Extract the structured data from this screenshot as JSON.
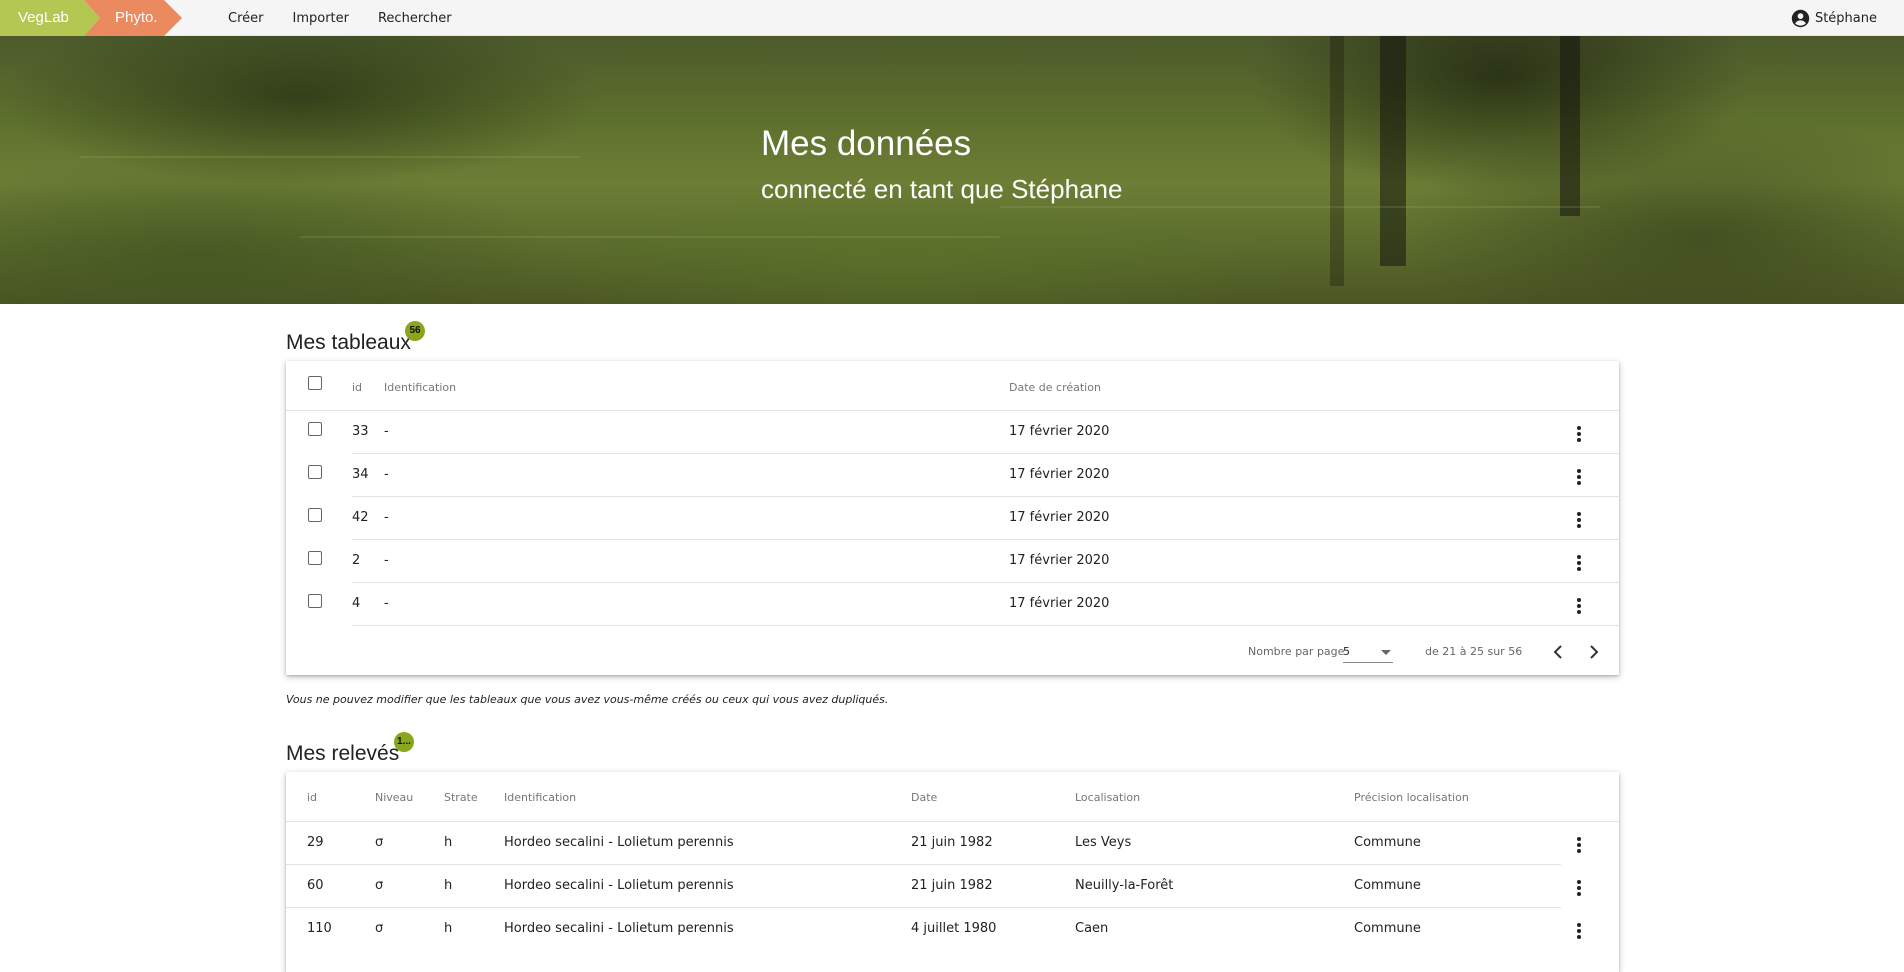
{
  "breadcrumb": {
    "app": "VegLab",
    "module": "Phyto."
  },
  "nav": {
    "create": "Créer",
    "import": "Importer",
    "search": "Rechercher"
  },
  "user": {
    "name": "Stéphane",
    "icon": "account-circle-icon"
  },
  "hero": {
    "title": "Mes données",
    "subtitle": "connecté en tant que Stéphane"
  },
  "tables_section": {
    "title": "Mes tableaux",
    "count": "56",
    "headers": {
      "id": "id",
      "identification": "Identification",
      "date": "Date de création"
    },
    "rows": [
      {
        "id": "33",
        "identification": "-",
        "date": "17 février 2020"
      },
      {
        "id": "34",
        "identification": "-",
        "date": "17 février 2020"
      },
      {
        "id": "42",
        "identification": "-",
        "date": "17 février 2020"
      },
      {
        "id": "2",
        "identification": "-",
        "date": "17 février 2020"
      },
      {
        "id": "4",
        "identification": "-",
        "date": "17 février 2020"
      }
    ],
    "paginator": {
      "per_page_label": "Nombre par page",
      "per_page_value": "5",
      "range_label": "de 21 à 25 sur 56"
    },
    "note": "Vous ne pouvez modifier que les tableaux que vous avez vous-même créés ou ceux qui vous avez dupliqués."
  },
  "releves_section": {
    "title": "Mes relevés",
    "count": "1...",
    "headers": {
      "id": "id",
      "niveau": "Niveau",
      "strate": "Strate",
      "identification": "Identification",
      "date": "Date",
      "localisation": "Localisation",
      "precision": "Précision localisation"
    },
    "rows": [
      {
        "id": "29",
        "niveau": "σ",
        "strate": "h",
        "identification": "Hordeo secalini - Lolietum perennis",
        "date": "21 juin 1982",
        "localisation": "Les Veys",
        "precision": "Commune"
      },
      {
        "id": "60",
        "niveau": "σ",
        "strate": "h",
        "identification": "Hordeo secalini - Lolietum perennis",
        "date": "21 juin 1982",
        "localisation": "Neuilly-la-Forêt",
        "precision": "Commune"
      },
      {
        "id": "110",
        "niveau": "σ",
        "strate": "h",
        "identification": "Hordeo secalini - Lolietum perennis",
        "date": "4 juillet 1980",
        "localisation": "Caen",
        "precision": "Commune"
      }
    ]
  },
  "colors": {
    "veglab": "#b3c752",
    "phyto": "#ec8a5f",
    "badge": "#8aa61c"
  }
}
